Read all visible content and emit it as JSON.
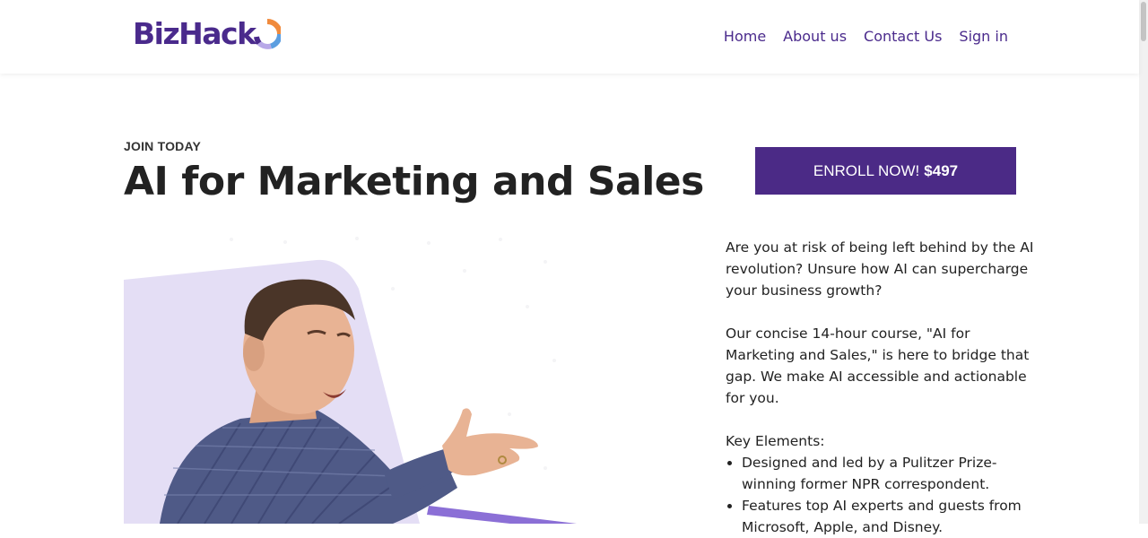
{
  "brand": {
    "name": "BizHack",
    "colors": {
      "primary": "#4a2a8c",
      "accent_orange": "#f08a3c",
      "accent_blue": "#5c9ee0",
      "accent_lavender": "#b8a8e8"
    }
  },
  "nav": {
    "items": [
      "Home",
      "About us",
      "Contact Us",
      "Sign in"
    ]
  },
  "hero": {
    "eyebrow": "JOIN TODAY",
    "title": "AI for Marketing and Sales",
    "image": "presenter-photo"
  },
  "enroll": {
    "label": "ENROLL NOW!",
    "price": "$497"
  },
  "description": {
    "paragraph1": "Are you at risk of being left behind by the AI revolution? Unsure how AI can supercharge your business growth?",
    "paragraph2": "Our concise 14-hour course, \"AI for Marketing and Sales,\" is here to bridge that gap. We make AI accessible and actionable for you.",
    "key_heading": "Key Elements:",
    "bullets": [
      "Designed and led by a Pulitzer Prize-winning former NPR correspondent.",
      "Features top AI experts and guests from Microsoft, Apple, and Disney."
    ]
  }
}
